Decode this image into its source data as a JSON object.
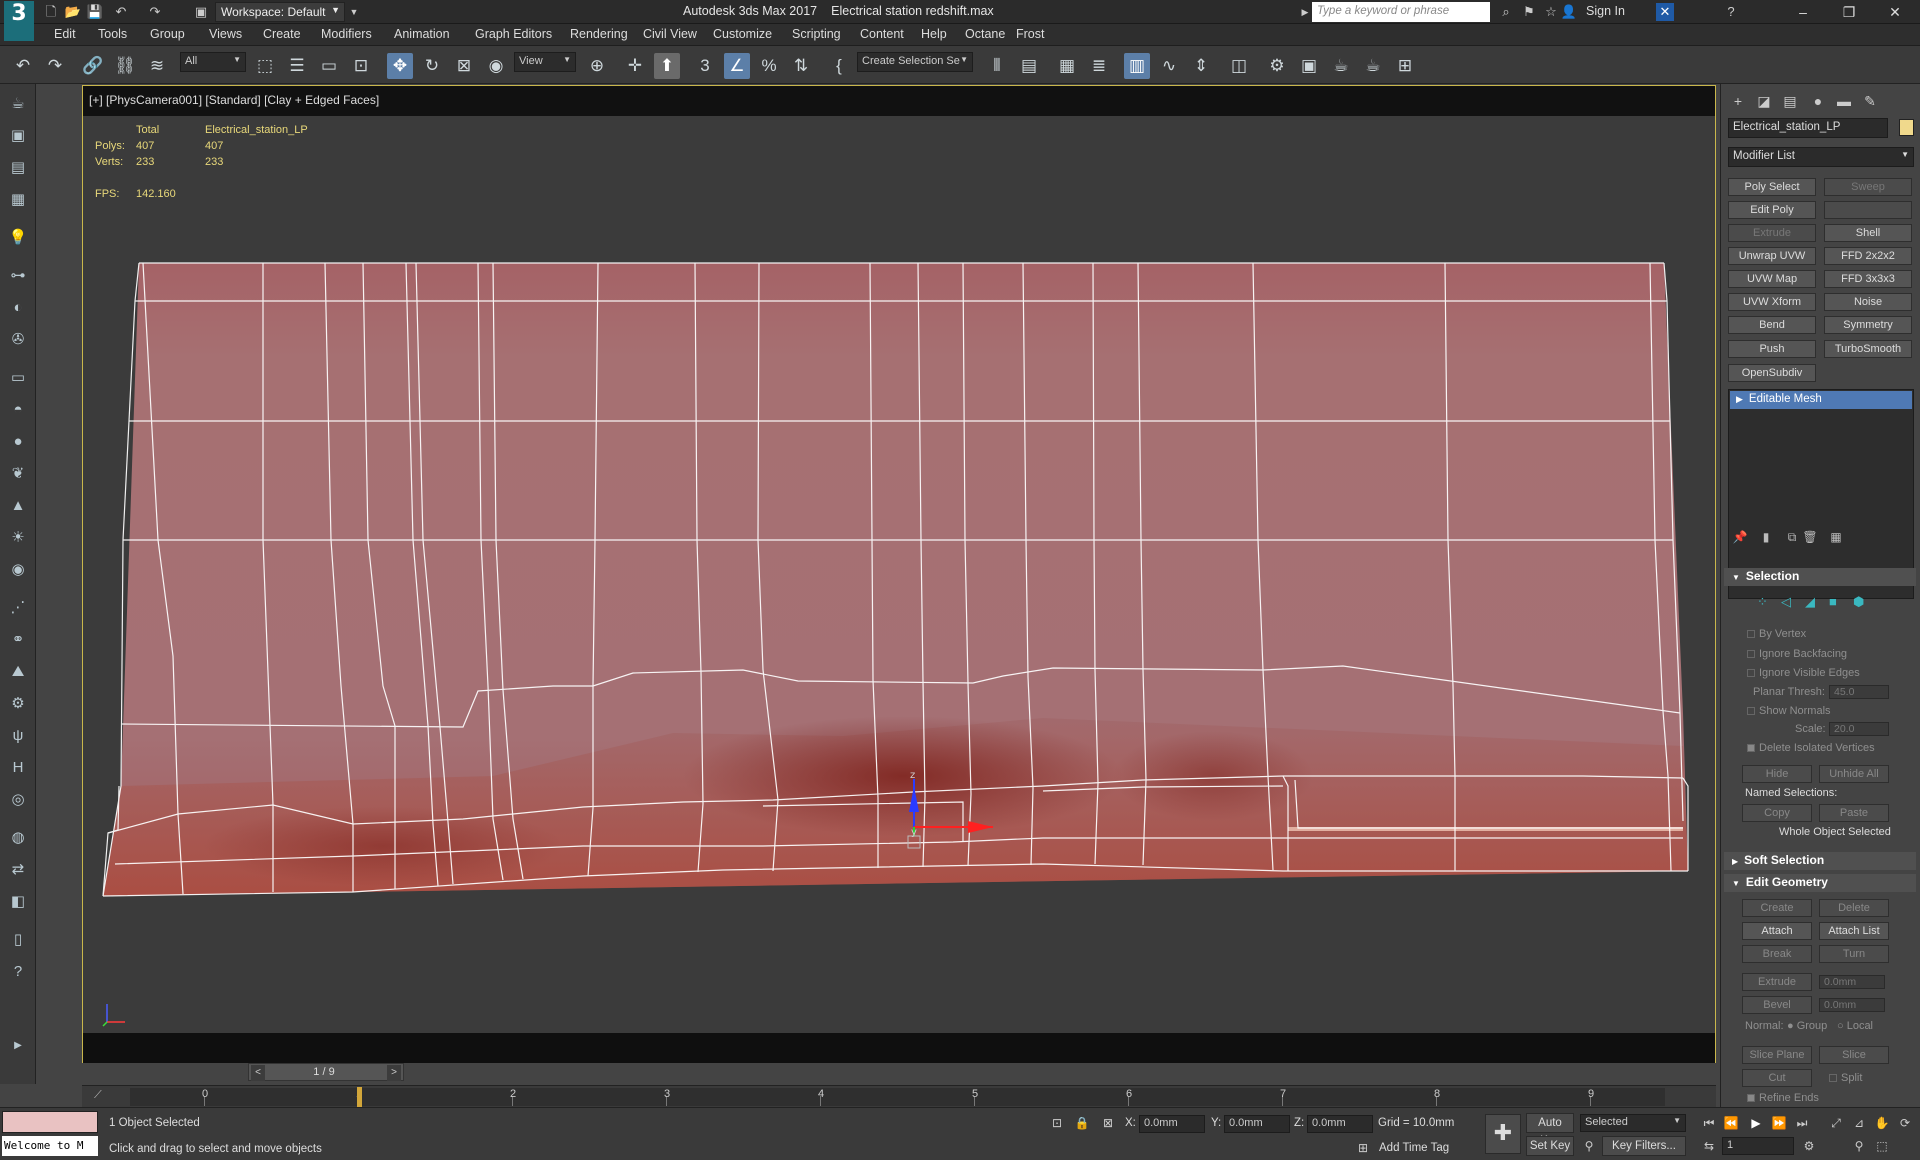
{
  "app": {
    "title": "Autodesk 3ds Max 2017",
    "file": "Electrical station redshift.max",
    "workspace": "Workspace: Default",
    "search_placeholder": "Type a keyword or phrase",
    "sign_in": "Sign In"
  },
  "menu": [
    "Edit",
    "Tools",
    "Group",
    "Views",
    "Create",
    "Modifiers",
    "Animation",
    "Graph Editors",
    "Rendering",
    "Civil View",
    "Customize",
    "Scripting",
    "Content",
    "Help",
    "Octane",
    "Frost"
  ],
  "toolbar": {
    "filter": "All",
    "ref_coord": "View",
    "selection_set": "Create Selection Se"
  },
  "viewport": {
    "label": "[+] [PhysCamera001] [Standard] [Clay + Edged Faces]",
    "stats": {
      "total_label": "Total",
      "object_label": "Electrical_station_LP",
      "polys_label": "Polys:",
      "polys_total": "407",
      "polys_object": "407",
      "verts_label": "Verts:",
      "verts_total": "233",
      "verts_object": "233",
      "fps_label": "FPS:",
      "fps_value": "142.160"
    },
    "gizmo_z": "z",
    "gizmo_y": "y"
  },
  "timeline": {
    "pager": "1 / 9",
    "ticks": [
      "0",
      "1",
      "2",
      "3",
      "4",
      "5",
      "6",
      "7",
      "8",
      "9"
    ]
  },
  "status": {
    "selected": "1 Object Selected",
    "hint": "Click and drag to select and move objects",
    "welcome": "Welcome to M",
    "x_label": "X:",
    "x_value": "0.0mm",
    "y_label": "Y:",
    "y_value": "0.0mm",
    "z_label": "Z:",
    "z_value": "0.0mm",
    "grid": "Grid = 10.0mm",
    "add_time_tag": "Add Time Tag",
    "auto_key": "Auto Key",
    "set_key": "Set Key",
    "selected_dropdown": "Selected",
    "key_filters": "Key Filters...",
    "frame": "1"
  },
  "command_panel": {
    "object_name": "Electrical_station_LP",
    "object_color": "#f0d98c",
    "modifier_list": "Modifier List",
    "modifier_buttons": [
      {
        "label": "Poly Select",
        "enabled": true
      },
      {
        "label": "Sweep",
        "enabled": false
      },
      {
        "label": "Edit Poly",
        "enabled": true
      },
      {
        "label": "",
        "enabled": false
      },
      {
        "label": "Extrude",
        "enabled": false
      },
      {
        "label": "Shell",
        "enabled": true
      },
      {
        "label": "Unwrap UVW",
        "enabled": true
      },
      {
        "label": "FFD 2x2x2",
        "enabled": true
      },
      {
        "label": "UVW Map",
        "enabled": true
      },
      {
        "label": "FFD 3x3x3",
        "enabled": true
      },
      {
        "label": "UVW Xform",
        "enabled": true
      },
      {
        "label": "Noise",
        "enabled": true
      },
      {
        "label": "Bend",
        "enabled": true
      },
      {
        "label": "Symmetry",
        "enabled": true
      },
      {
        "label": "Push",
        "enabled": true
      },
      {
        "label": "TurboSmooth",
        "enabled": true
      },
      {
        "label": "OpenSubdiv",
        "enabled": true
      }
    ],
    "stack_item": "Editable Mesh",
    "selection": {
      "title": "Selection",
      "by_vertex": "By Vertex",
      "ignore_backfacing": "Ignore Backfacing",
      "ignore_visible_edges": "Ignore Visible Edges",
      "planar_thresh_label": "Planar Thresh:",
      "planar_thresh": "45.0",
      "show_normals": "Show Normals",
      "scale_label": "Scale:",
      "scale": "20.0",
      "delete_isolated": "Delete Isolated Vertices",
      "hide": "Hide",
      "unhide_all": "Unhide All",
      "named_selections": "Named Selections:",
      "copy": "Copy",
      "paste": "Paste",
      "whole_object": "Whole Object Selected"
    },
    "soft_selection": "Soft Selection",
    "edit_geometry": {
      "title": "Edit Geometry",
      "create": "Create",
      "delete": "Delete",
      "attach": "Attach",
      "attach_list": "Attach List",
      "break": "Break",
      "turn": "Turn",
      "extrude": "Extrude",
      "extrude_val": "0.0mm",
      "bevel": "Bevel",
      "bevel_val": "0.0mm",
      "normal_label": "Normal:",
      "group": "Group",
      "local": "Local",
      "slice_plane": "Slice Plane",
      "slice": "Slice",
      "cut": "Cut",
      "split": "Split",
      "refine_ends": "Refine Ends"
    }
  }
}
